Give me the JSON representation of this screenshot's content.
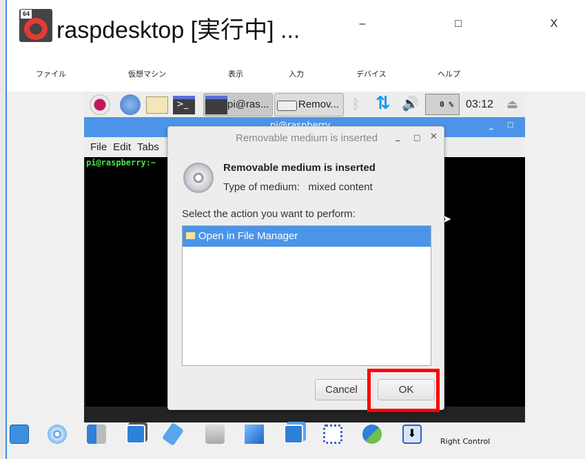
{
  "window": {
    "title": "raspdesktop [実行中] ...",
    "badge": "64",
    "minimize": "–",
    "maximize": "□",
    "close": "X"
  },
  "menubar": [
    "ファイル",
    "仮想マシン",
    "表示",
    "入力",
    "デバイス",
    "ヘルプ"
  ],
  "taskbar": {
    "terminal_task": "pi@ras...",
    "removable_task": "Remov...",
    "cpu": "0 %",
    "clock": "03:12"
  },
  "terminal": {
    "title": "pi@raspberry",
    "menu": [
      "File",
      "Edit",
      "Tabs"
    ],
    "prompt": "pi@raspberry:~"
  },
  "dialog": {
    "title": "Removable medium is inserted",
    "heading": "Removable medium is inserted",
    "type_label": "Type of medium:",
    "type_value": "mixed content",
    "instruction": "Select the action you want to perform:",
    "actions": [
      "Open in File Manager"
    ],
    "cancel": "Cancel",
    "ok": "OK"
  },
  "statusbar": {
    "host_key": "Right Control",
    "icons": [
      "hard-disk-icon",
      "optical-disk-icon",
      "audio-icon",
      "network-icon",
      "usb-icon",
      "shared-folder-icon",
      "display-icon",
      "recording-icon",
      "cpu-icon",
      "mouse-integration-icon",
      "download-icon"
    ]
  },
  "colors": {
    "highlight": "#4a95ea",
    "terminal_title": "#4d94e8",
    "annotation": "#ff0000"
  }
}
